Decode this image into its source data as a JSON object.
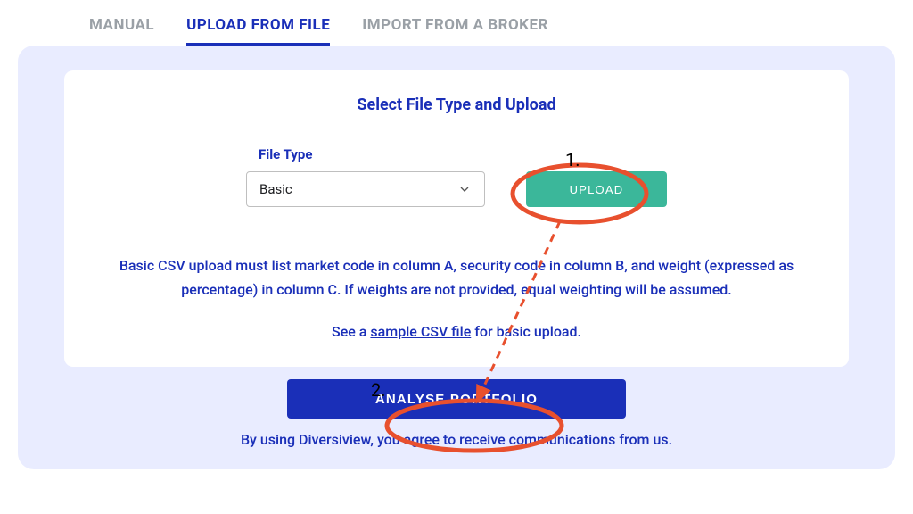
{
  "tabs": {
    "manual": "MANUAL",
    "upload": "UPLOAD FROM FILE",
    "import": "IMPORT FROM A BROKER"
  },
  "panel": {
    "title": "Select File Type and Upload",
    "file_type_label": "File Type",
    "file_type_value": "Basic",
    "upload_button": "UPLOAD",
    "help_text": "Basic CSV upload must list market code in column A, security code in column B, and weight (expressed as percentage) in column C. If weights are not provided, equal weighting will be assumed.",
    "sample_prefix": "See a ",
    "sample_link": "sample CSV file",
    "sample_suffix": " for basic upload."
  },
  "analyse_button": "ANALYSE PORTFOLIO",
  "agree_text": "By using Diversiview, you agree to receive communications from us.",
  "annotations": {
    "step1": "1.",
    "step2": "2."
  },
  "colors": {
    "primary": "#1a2fb8",
    "accent_green": "#3bb79a",
    "panel_bg": "#e9ecff",
    "annotation": "#e8502e"
  }
}
